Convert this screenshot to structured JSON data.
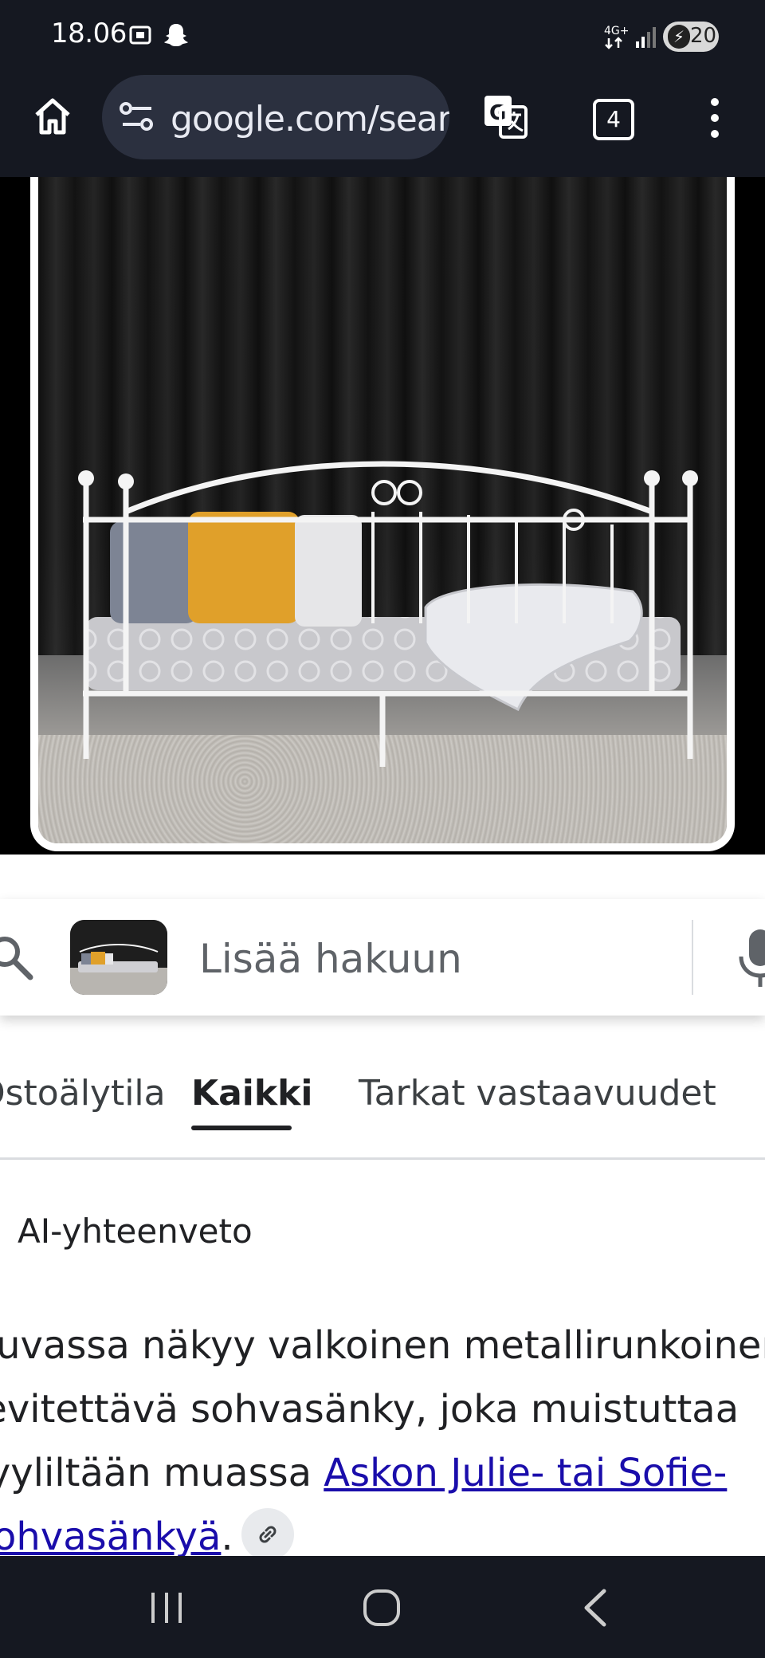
{
  "status_bar": {
    "time": "18.06",
    "network": "4G+",
    "battery_level": "20"
  },
  "browser": {
    "url": "google.com/search",
    "tab_count": "4",
    "icons": [
      "home-icon",
      "site-settings-icon",
      "translate-icon",
      "tabs-icon",
      "more-icon"
    ]
  },
  "search": {
    "placeholder": "Lisää hakuun"
  },
  "tabs": [
    {
      "label": "Ostoälytila"
    },
    {
      "label": "Kaikki",
      "selected": true
    },
    {
      "label": "Tarkat vastaavuudet"
    }
  ],
  "ai_overview": {
    "title": "AI-yhteenveto",
    "line1": "Kuvassa näkyy valkoinen metallirunkoinen",
    "line2": "levitettävä sohvasänky, joka muistuttaa",
    "line3_text": "tyyliltään muassa ",
    "line3_link": "Askon Julie- tai Sofie-",
    "line4_link": "sohvasänkyä",
    "line4_end": "."
  },
  "colors": {
    "chrome_bg": "#151821",
    "url_bar_bg": "#2b303f",
    "link": "#1a0dab",
    "accent_pillow": "#e0a02a"
  }
}
